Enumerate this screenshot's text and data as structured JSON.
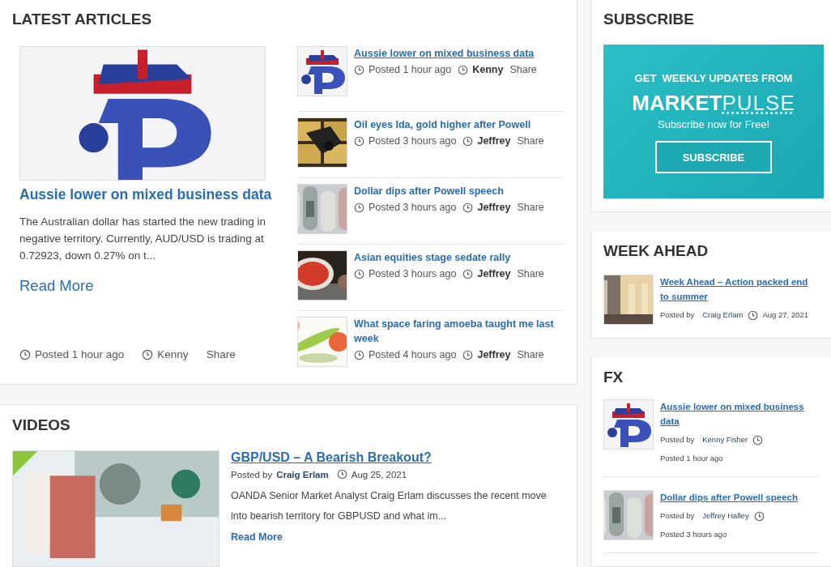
{
  "latest": {
    "title": "LATEST ARTICLES",
    "featured": {
      "title": "Aussie lower on mixed business data",
      "excerpt": "The Australian dollar has started the new trading in negative territory. Currently, AUD/USD is trading at 0.72923, down 0.27% on t...",
      "read_more": "Read More",
      "posted": "Posted 1 hour ago",
      "author": "Kenny",
      "share": "Share"
    },
    "list": [
      {
        "title": "Aussie lower on mixed business data",
        "hovered": true,
        "posted": "Posted 1 hour ago",
        "author": "Kenny",
        "share": "Share"
      },
      {
        "title": "Oil eyes Ida, gold higher after Powell",
        "hovered": false,
        "posted": "Posted 3 hours ago",
        "author": "Jeffrey",
        "share": "Share"
      },
      {
        "title": "Dollar dips after Powell speech",
        "hovered": false,
        "posted": "Posted 3 hours ago",
        "author": "Jeffrey",
        "share": "Share"
      },
      {
        "title": "Asian equities stage sedate rally",
        "hovered": false,
        "posted": "Posted 3 hours ago",
        "author": "Jeffrey",
        "share": "Share"
      },
      {
        "title": "What space faring amoeba taught me last week",
        "hovered": false,
        "posted": "Posted 4 hours ago",
        "author": "Jeffrey",
        "share": "Share"
      }
    ]
  },
  "videos": {
    "title": "VIDEOS",
    "item": {
      "title": "GBP/USD – A Bearish Breakout?",
      "posted_by": "Posted by",
      "author": "Craig Erlam",
      "date": "Aug 25, 2021",
      "description": "OANDA Senior Market Analyst Craig Erlam discusses the recent move into bearish territory for GBPUSD and what im...",
      "read_more": "Read More"
    }
  },
  "subscribe": {
    "title": "SUBSCRIBE",
    "headline": "GET  WEEKLY UPDATES FROM",
    "brand_bold": "MARKET",
    "brand_dotted": "PULSE",
    "tagline": "Subscribe now for Free!",
    "button": "SUBSCRIBE"
  },
  "week_ahead": {
    "title": "WEEK AHEAD",
    "items": [
      {
        "title": "Week Ahead – Action packed end to summer",
        "posted_by": "Posted by",
        "author": "Craig Erlam",
        "time": "Aug 27, 2021"
      }
    ]
  },
  "fx": {
    "title": "FX",
    "items": [
      {
        "title": "Aussie lower on mixed business data",
        "posted_by": "Posted by",
        "author": "Kenny Fisher",
        "time": "Posted 1 hour ago"
      },
      {
        "title": "Dollar dips after Powell speech",
        "posted_by": "Posted by",
        "author": "Jeffrey Halley",
        "time": "Posted 3 hours ago"
      }
    ]
  }
}
